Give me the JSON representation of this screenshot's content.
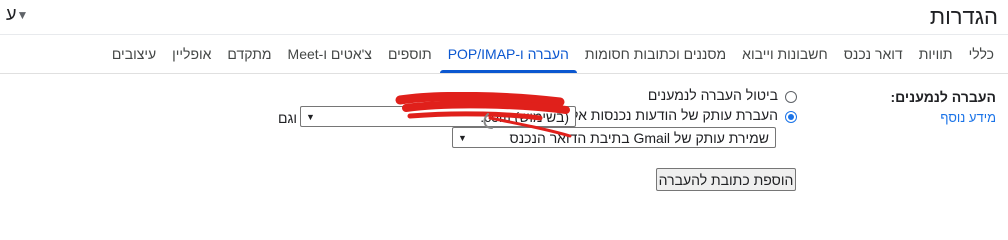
{
  "header": {
    "title": "הגדרות",
    "input_tool_label": "ע"
  },
  "tabs": [
    {
      "label": "כללי",
      "active": false
    },
    {
      "label": "תוויות",
      "active": false
    },
    {
      "label": "דואר נכנס",
      "active": false
    },
    {
      "label": "חשבונות וייבוא",
      "active": false
    },
    {
      "label": "מסננים וכתובות חסומות",
      "active": false
    },
    {
      "label": "העברה ו-POP/IMAP",
      "active": true
    },
    {
      "label": "תוספים",
      "active": false
    },
    {
      "label": "צ'אטים ו-Meet",
      "active": false
    },
    {
      "label": "מתקדם",
      "active": false
    },
    {
      "label": "אופליין",
      "active": false
    },
    {
      "label": "עיצובים",
      "active": false
    }
  ],
  "forwarding": {
    "section_label": "העברה לנמענים:",
    "learn_more": "מידע נוסף",
    "option_disable": "ביטול העברה לנמענים",
    "option_forward": "העברת עותק של הודעות נכנסות אל",
    "selected_option": "forward",
    "address_select_value": ".com (בשימוש)",
    "and_label": "וגם",
    "action_select_value": "שמירת עותק של Gmail בתיבת הדואר הנכנס",
    "add_button": "הוספת כתובת להעברה"
  },
  "colors": {
    "accent": "#0b57d0",
    "link": "#1a73e8",
    "redaction": "#e0201b"
  }
}
